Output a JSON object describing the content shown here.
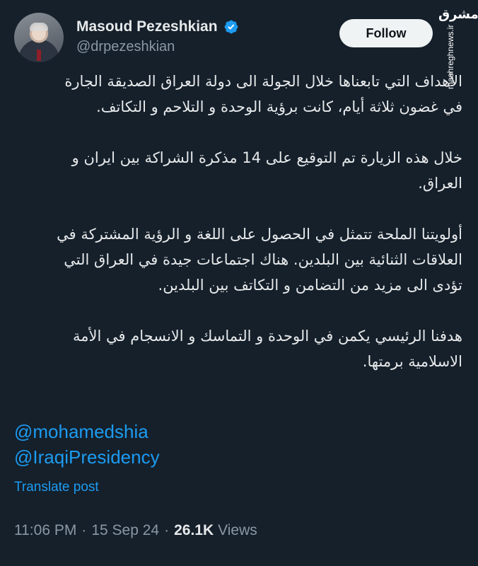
{
  "author": {
    "name": "Masoud Pezeshkian",
    "handle": "@drpezeshkian",
    "verified": true
  },
  "follow_label": "Follow",
  "watermark": {
    "logo_text": "مشرق",
    "url": "mashreghnews.ir"
  },
  "tweet": {
    "paragraphs": [
      "الأهداف التي تابعناها خلال الجولة الى دولة العراق الصديقة الجارة\nفي غضون ثلاثة أيام، كانت برؤية الوحدة و التلاحم و التكاتف.",
      "خلال هذه الزيارة تم التوقيع على 14 مذكرة الشراكة بين ايران و\nالعراق.",
      "أولويتنا الملحة تتمثل في الحصول على اللغة و الرؤية المشتركة في\nالعلاقات الثنائية بين البلدين. هناك اجتماعات جيدة في العراق التي\nتؤدى الى مزيد من التضامن و التكاتف بين البلدين.",
      "هدفنا الرئيسي يكمن في الوحدة و التماسك و الانسجام في الأمة\nالاسلامية برمتها."
    ],
    "mentions": [
      "@mohamedshia",
      "@IraqiPresidency"
    ],
    "translate_label": "Translate post"
  },
  "meta": {
    "time": "11:06 PM",
    "separator": "·",
    "date": "15 Sep 24",
    "views_count": "26.1K",
    "views_label": "Views"
  },
  "colors": {
    "background": "#15202b",
    "text": "#e7e9ea",
    "secondary": "#8b98a5",
    "link": "#1d9bf0",
    "verified": "#1d9bf0",
    "follow_bg": "#eff3f4"
  }
}
